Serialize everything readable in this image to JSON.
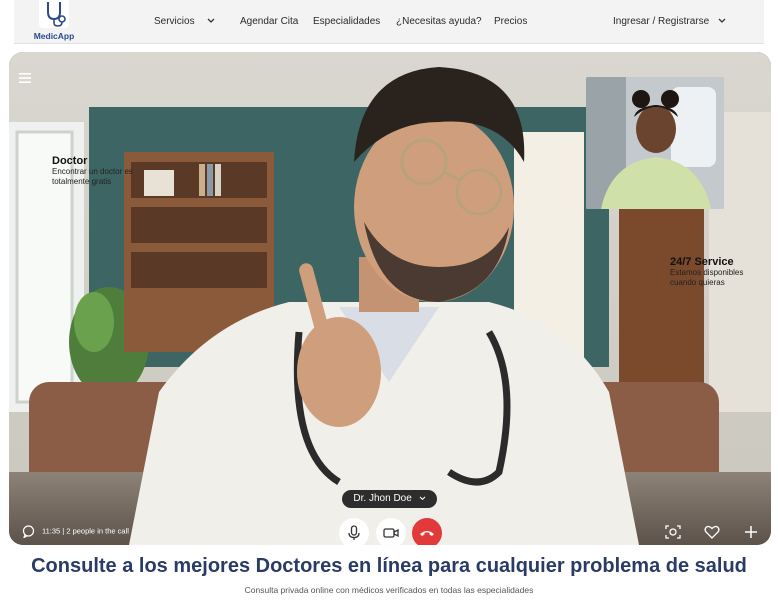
{
  "brand": {
    "name": "MedicApp",
    "color": "#2b4a8c"
  },
  "nav": {
    "items": [
      {
        "label": "Servicios",
        "has_dropdown": true
      },
      {
        "label": "Agendar Cita",
        "has_dropdown": false
      },
      {
        "label": "Especialidades",
        "has_dropdown": false
      },
      {
        "label": "¿Necesitas ayuda?",
        "has_dropdown": false
      },
      {
        "label": "Precios",
        "has_dropdown": false
      }
    ],
    "account": {
      "label": "Ingresar / Registrarse",
      "has_dropdown": true
    }
  },
  "hero": {
    "tags": [
      {
        "title": "Doctor",
        "text": "Encontrar un doctor es totalmente gratis"
      },
      {
        "title": "24/7 Service",
        "text": "Estamos disponibles cuando quieras"
      }
    ],
    "call": {
      "doctor_name": "Dr. Jhon Doe",
      "status": "11:35 | 2 people in the call",
      "end_call_color": "#e23a3a"
    },
    "icons": {
      "menu": "hamburger-menu-icon",
      "chat": "chat-bubble-icon",
      "mic": "microphone-icon",
      "video": "video-camera-icon",
      "end": "phone-hangup-icon",
      "screenshot": "camera-capture-icon",
      "favorite": "heart-icon",
      "add": "plus-icon"
    }
  },
  "headline": "Consulte a los mejores Doctores en línea para cualquier problema de salud",
  "subheadline": "Consulta privada online con médicos verificados en todas las especialidades",
  "colors": {
    "headline": "#2a3c66"
  }
}
